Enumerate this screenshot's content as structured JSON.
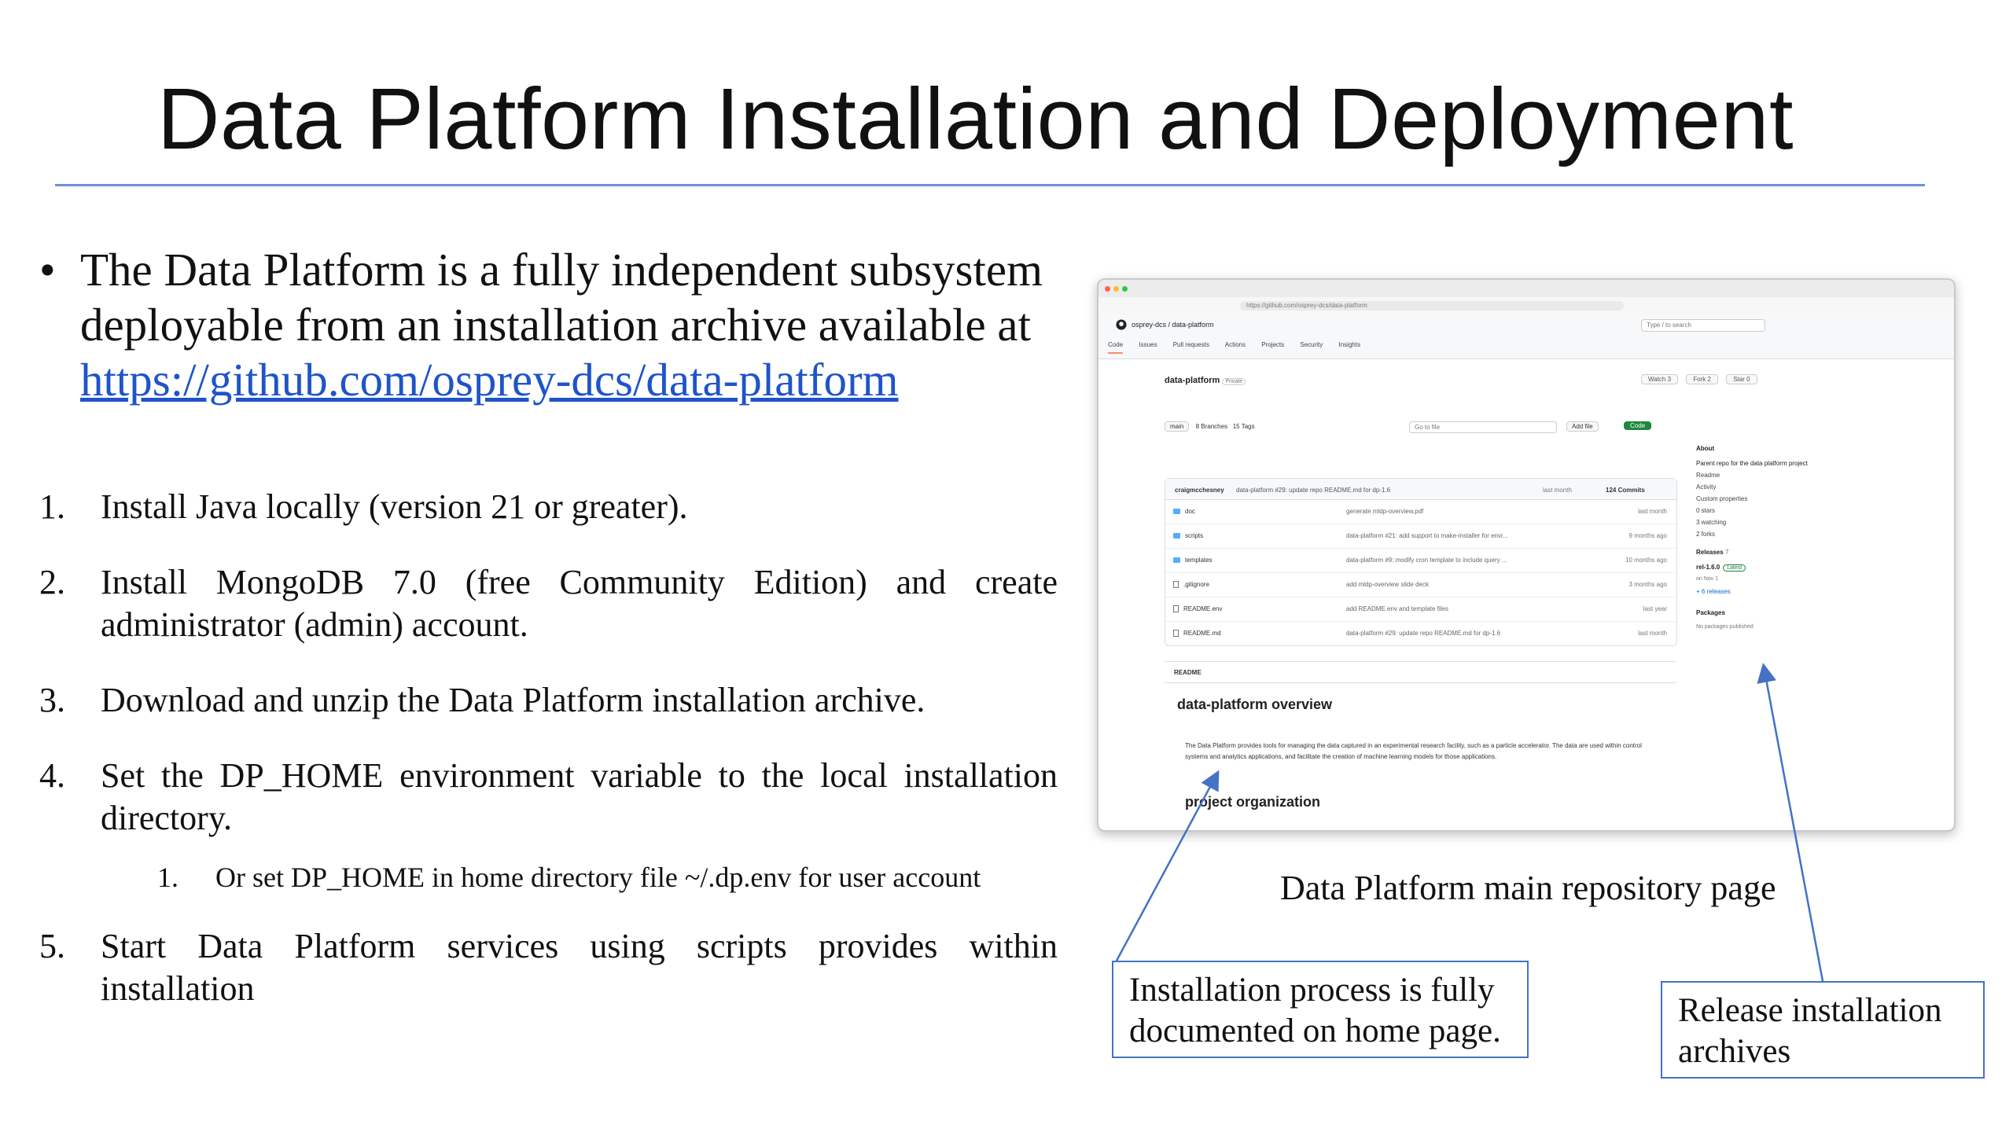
{
  "slide": {
    "title": "Data Platform Installation and Deployment",
    "intro_bullet": "•",
    "intro_text": "The Data Platform is a fully independent subsystem deployable from an installation archive available at ",
    "intro_link": "https://github.com/osprey-dcs/data-platform",
    "steps": [
      {
        "num": "1.",
        "text": "Install Java locally (version 21 or greater)."
      },
      {
        "num": "2.",
        "text": "Install MongoDB 7.0 (free Community Edition) and create administrator (admin) account."
      },
      {
        "num": "3.",
        "text": "Download and unzip the Data Platform installation archive."
      },
      {
        "num": "4.",
        "text": "Set the DP_HOME environment variable to the local installation directory."
      },
      {
        "num": "5.",
        "text": "Start Data Platform services using scripts provides within installation"
      }
    ],
    "substep": {
      "num": "1.",
      "text": "Or set DP_HOME in home directory file ~/.dp.env for user account"
    },
    "caption": "Data Platform main repository page",
    "callout_left": "Installation process is fully documented on home page.",
    "callout_right": "Release installation archives",
    "arrow_color": "#4472c4",
    "rule_color": "#6f8fd6",
    "link_color": "#1f54c9"
  },
  "screenshot": {
    "url": "https://github.com/osprey-dcs/data-platform",
    "crumb": "osprey-dcs / data-platform",
    "search_placeholder": "Type / to search",
    "tabs": [
      "Code",
      "Issues",
      "Pull requests",
      "Actions",
      "Projects",
      "Security",
      "Insights"
    ],
    "repo_name": "data-platform",
    "visibility": "Private",
    "repo_buttons": [
      "Watch 3",
      "Fork 2",
      "Star 0"
    ],
    "branch": "main",
    "branches": "8 Branches",
    "tags": "15 Tags",
    "go_to_file": "Go to file",
    "add_file": "Add file",
    "code_button": "Code",
    "commit": {
      "author": "craigmcchesney",
      "message": "data-platform #29: update repo README.md for dp-1.6",
      "meta": "last month",
      "count": "124 Commits"
    },
    "files": [
      {
        "name": "doc",
        "type": "folder",
        "msg": "generate mldp-overview.pdf",
        "when": "last month"
      },
      {
        "name": "scripts",
        "type": "folder",
        "msg": "data-platform #21: add support to make-installer for envi...",
        "when": "9 months ago"
      },
      {
        "name": "templates",
        "type": "folder",
        "msg": "data-platform #9: modify cron template to include query ...",
        "when": "10 months ago"
      },
      {
        "name": ".gitignore",
        "type": "file",
        "msg": "add mldp-overview slide deck",
        "when": "3 months ago"
      },
      {
        "name": "README.env",
        "type": "file",
        "msg": "add README.env and template files",
        "when": "last year"
      },
      {
        "name": "README.md",
        "type": "file",
        "msg": "data-platform #29: update repo README.md for dp-1.6",
        "when": "last month"
      }
    ],
    "readme_tab": "README",
    "readme_title": "data-platform overview",
    "readme_paragraph": "The Data Platform provides tools for managing the data captured in an experimental research facility, such as a particle accelerator. The data are used within control systems and analytics applications, and facilitate the creation of machine learning models for those applications.",
    "readme_subtitle": "project organization",
    "about": {
      "heading": "About",
      "description": "Parent repo for the data platform project",
      "items": [
        "Readme",
        "Activity",
        "Custom properties",
        "0 stars",
        "3 watching",
        "2 forks"
      ],
      "releases_heading": "Releases",
      "releases_count": "7",
      "release": "rel-1.6.0",
      "release_badge": "Latest",
      "release_date": "on Nov 1",
      "more_releases": "+ 6 releases",
      "packages_heading": "Packages",
      "packages_text": "No packages published"
    }
  }
}
